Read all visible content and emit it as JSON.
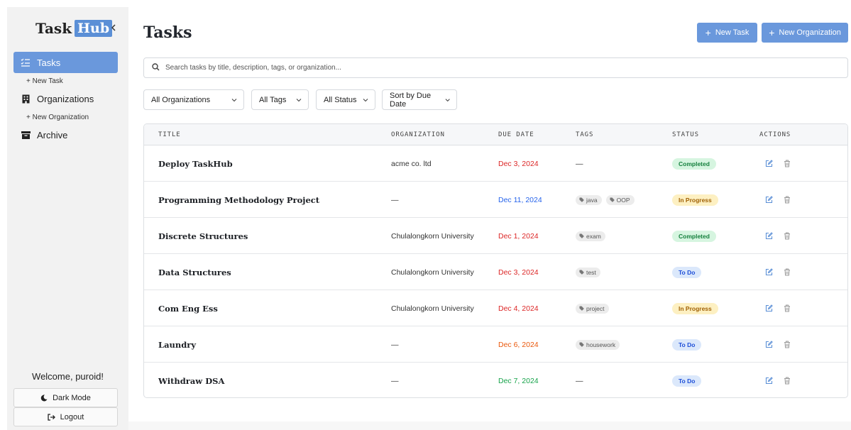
{
  "app": {
    "logo_task": "Task",
    "logo_hub": "Hub"
  },
  "sidebar": {
    "items": [
      {
        "label": "Tasks",
        "active": true
      },
      {
        "label": "Organizations",
        "active": false
      },
      {
        "label": "Archive",
        "active": false
      }
    ],
    "new_task_link": "+ New Task",
    "new_org_link": "+ New Organization",
    "welcome": "Welcome, puroid!",
    "dark_mode_label": "Dark Mode",
    "logout_label": "Logout"
  },
  "header": {
    "title": "Tasks",
    "new_task_label": "New Task",
    "new_org_label": "New Organization"
  },
  "search": {
    "placeholder": "Search tasks by title, description, tags, or organization..."
  },
  "filters": {
    "organization": "All Organizations",
    "tags": "All Tags",
    "status": "All Status",
    "sort": "Sort by Due Date"
  },
  "table": {
    "columns": [
      "TITLE",
      "ORGANIZATION",
      "DUE DATE",
      "TAGS",
      "STATUS",
      "ACTIONS"
    ],
    "rows": [
      {
        "title": "Deploy TaskHub",
        "organization": "acme co. ltd",
        "due_date": "Dec 3, 2024",
        "due_color": "#dc2626",
        "tags": [],
        "tags_empty": "—",
        "status": "Completed",
        "status_kind": "completed"
      },
      {
        "title": "Programming Methodology Project",
        "organization": "—",
        "due_date": "Dec 11, 2024",
        "due_color": "#2563eb",
        "tags": [
          "java",
          "OOP"
        ],
        "tags_empty": "",
        "status": "In Progress",
        "status_kind": "progress"
      },
      {
        "title": "Discrete Structures",
        "organization": "Chulalongkorn University",
        "due_date": "Dec 1, 2024",
        "due_color": "#dc2626",
        "tags": [
          "exam"
        ],
        "tags_empty": "",
        "status": "Completed",
        "status_kind": "completed"
      },
      {
        "title": "Data Structures",
        "organization": "Chulalongkorn University",
        "due_date": "Dec 3, 2024",
        "due_color": "#dc2626",
        "tags": [
          "test"
        ],
        "tags_empty": "",
        "status": "To Do",
        "status_kind": "todo"
      },
      {
        "title": "Com Eng Ess",
        "organization": "Chulalongkorn University",
        "due_date": "Dec 4, 2024",
        "due_color": "#dc2626",
        "tags": [
          "project"
        ],
        "tags_empty": "",
        "status": "In Progress",
        "status_kind": "progress"
      },
      {
        "title": "Laundry",
        "organization": "—",
        "due_date": "Dec 6, 2024",
        "due_color": "#ea580c",
        "tags": [
          "housework"
        ],
        "tags_empty": "",
        "status": "To Do",
        "status_kind": "todo"
      },
      {
        "title": "Withdraw DSA",
        "organization": "—",
        "due_date": "Dec 7, 2024",
        "due_color": "#16a34a",
        "tags": [],
        "tags_empty": "—",
        "status": "To Do",
        "status_kind": "todo"
      }
    ]
  },
  "colors": {
    "accent": "#6a98dc",
    "completed_bg": "#d6f5e0",
    "completed_fg": "#15803d",
    "progress_bg": "#fdf0c2",
    "progress_fg": "#a16207",
    "todo_bg": "#dbe8fb",
    "todo_fg": "#1d4ed8",
    "edit_icon": "#5b8fd6",
    "delete_icon": "#9a9a9a"
  },
  "icons": {
    "collapse": "chevron-left-icon",
    "tasks": "list-check-icon",
    "organizations": "building-icon",
    "archive": "archive-box-icon",
    "dark_mode": "moon-icon",
    "logout": "logout-icon",
    "search": "search-icon",
    "edit": "edit-icon",
    "delete": "trash-icon",
    "tag": "tag-icon"
  }
}
